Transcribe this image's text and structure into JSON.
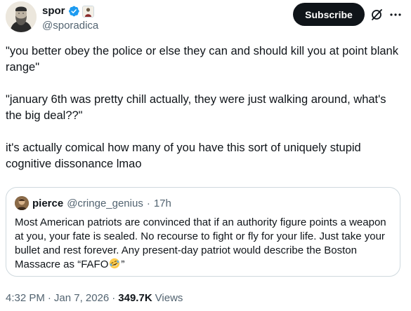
{
  "author": {
    "display_name": "spor",
    "handle": "@sporadica",
    "avatar_icon": "portrait-engraving-avatar",
    "verified_color": "#1d9bf0"
  },
  "actions": {
    "subscribe_label": "Subscribe",
    "grok_icon": "grok-icon",
    "more_icon": "more-dots-icon"
  },
  "tweet": {
    "paragraphs": [
      "\"you better obey the police or else they can and should kill you at point blank range\"",
      "\"january 6th was pretty chill actually, they were just walking around, what's the big deal??\"",
      "it's actually comical how many of you have this sort of uniquely stupid cognitive dissonance lmao"
    ]
  },
  "quote": {
    "display_name": "pierce",
    "handle": "@cringe_genius",
    "separator": "·",
    "time": "17h",
    "text_before_emoji": "Most American patriots are convinced that if an authority figure points a weapon at you, your fate is sealed. No recourse to fight or fly for your life. Just take your bullet and rest forever. Any present-day patriot would describe the Boston Massacre as “FAFO",
    "emoji": "rolling-on-floor-laughing-emoji",
    "text_after_emoji": "”"
  },
  "meta": {
    "time": "4:32 PM",
    "sep1": "·",
    "date": "Jan 7, 2026",
    "sep2": "·",
    "views_count": "349.7K",
    "views_label": "Views"
  }
}
